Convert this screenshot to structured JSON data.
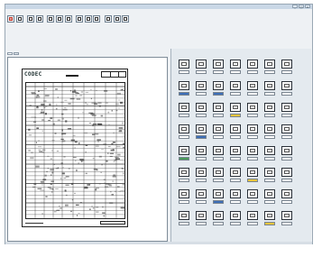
{
  "window": {
    "title": "",
    "controls": [
      "_",
      "□",
      "×"
    ]
  },
  "menu": [
    "",
    "",
    "",
    "",
    ""
  ],
  "toolbar": {
    "buttons": [
      "save-icon",
      "open-icon",
      "print-icon",
      "scan-icon",
      "preview-icon",
      "zoom-icon",
      "grid-icon",
      "recognize-icon",
      "settings-icon",
      "export-icon",
      "form-icon",
      "check-icon",
      "help-icon"
    ]
  },
  "info": {
    "line1": [
      "",
      "",
      ""
    ],
    "line2": [
      "",
      "",
      ""
    ],
    "line3": [
      "",
      "",
      "",
      "",
      "",
      ""
    ]
  },
  "tabs": [
    "",
    ""
  ],
  "document": {
    "code": "CODEC",
    "footer": ""
  },
  "colors": {
    "accent": "#3e6fb8",
    "highlight": "#e6c43c",
    "ok": "#4a9a5a"
  }
}
